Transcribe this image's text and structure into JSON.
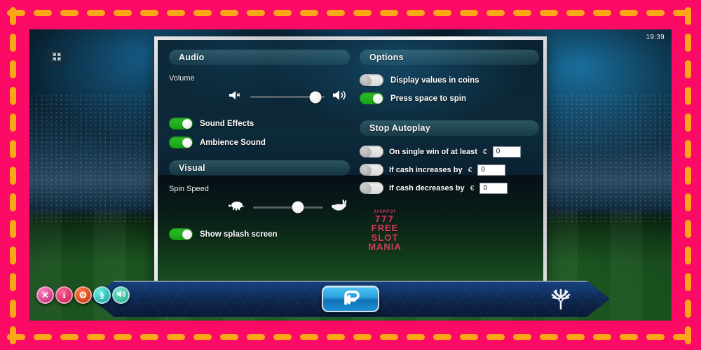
{
  "frame": {
    "border_color": "#fb0a66",
    "dash_color": "#fba617"
  },
  "screen": {
    "clock": "19:39",
    "fullscreen_icon": "exit-fullscreen-icon",
    "background": "soccer-stadium"
  },
  "settings": {
    "audio": {
      "title": "Audio",
      "volume_label": "Volume",
      "volume_value": 88,
      "mute_icon": "speaker-mute-icon",
      "max_icon": "speaker-loud-icon",
      "toggles": [
        {
          "label": "Sound Effects",
          "state": "on"
        },
        {
          "label": "Ambience Sound",
          "state": "on"
        }
      ]
    },
    "visual": {
      "title": "Visual",
      "spin_speed_label": "Spin Speed",
      "spin_speed_value": 64,
      "slow_icon": "turtle-icon",
      "fast_icon": "rabbit-icon",
      "toggles": [
        {
          "label": "Show splash screen",
          "state": "on"
        }
      ]
    },
    "options": {
      "title": "Options",
      "toggles": [
        {
          "label": "Display values in coins",
          "state": "off"
        },
        {
          "label": "Press space to spin",
          "state": "on"
        }
      ]
    },
    "stop_autoplay": {
      "title": "Stop Autoplay",
      "currency": "€",
      "rows": [
        {
          "label": "On single win of at least",
          "state": "off",
          "value": "0"
        },
        {
          "label": "If cash increases by",
          "state": "off",
          "value": "0"
        },
        {
          "label": "If cash decreases by",
          "state": "off",
          "value": "0"
        }
      ]
    }
  },
  "watermark": {
    "jackpot": "JACKPOT",
    "sevens": "777",
    "line1": "FREE",
    "line2": "SLOT",
    "line3": "MANIA"
  },
  "side_buttons": [
    {
      "name": "close-button",
      "glyph": "✕",
      "color": "#c21b6d"
    },
    {
      "name": "info-button",
      "glyph": "i",
      "color": "#c4104f"
    },
    {
      "name": "settings-button",
      "glyph": "⚙",
      "color": "#c42d0c"
    },
    {
      "name": "rules-button",
      "glyph": "§",
      "color": "#0f9e9b"
    },
    {
      "name": "sound-button",
      "glyph": "🔊",
      "color": "#16a08c"
    }
  ],
  "bottom_bar": {
    "back_button_icon": "return-arrow-icon",
    "right_icon": "snowflake-icon"
  }
}
